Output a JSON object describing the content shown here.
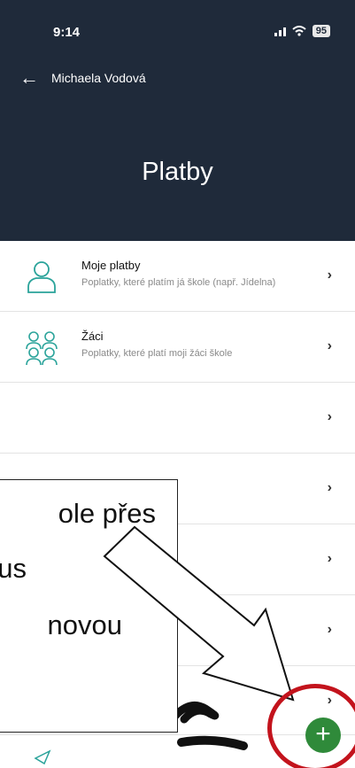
{
  "status_bar": {
    "time": "9:14",
    "battery": "95"
  },
  "header": {
    "back_name": "Michaela Vodová",
    "title": "Platby"
  },
  "rows": [
    {
      "title": "Moje platby",
      "subtitle": "Poplatky, které platím já škole (např. Jídelna)"
    },
    {
      "title": "Žáci",
      "subtitle": "Poplatky, které platí moji žáci škole"
    },
    {
      "title": "",
      "subtitle": ""
    },
    {
      "title": "",
      "subtitle": ""
    },
    {
      "title": "",
      "subtitle": ""
    },
    {
      "title": "",
      "subtitle": ""
    },
    {
      "title": "",
      "subtitle": ""
    }
  ],
  "callout": {
    "line1": "ole přes",
    "line2": "us",
    "line3": "novou"
  },
  "fab": {
    "label": "+"
  },
  "colors": {
    "header_bg": "#1f2a3a",
    "icon_teal": "#2aa39a",
    "fab_green": "#2f8a3a",
    "annotation_red": "#c3131c"
  },
  "icons": {
    "back": "arrow-left-icon",
    "row1": "person-outline-icon",
    "row2": "people-group-icon",
    "chevron": "chevron-right-icon",
    "fab": "plus-icon"
  }
}
